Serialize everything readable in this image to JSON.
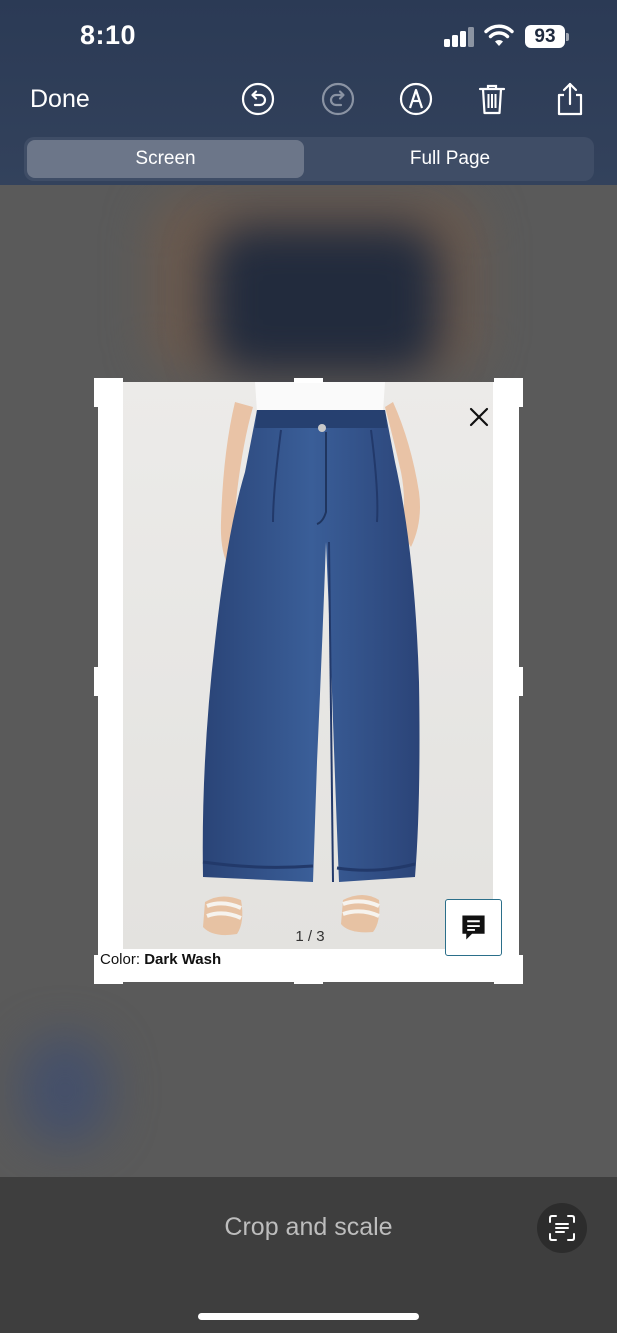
{
  "status": {
    "time": "8:10",
    "battery": "93"
  },
  "toolbar": {
    "done_label": "Done",
    "icons": [
      "undo-icon",
      "redo-icon",
      "markup-pen-icon",
      "trash-icon",
      "share-icon"
    ]
  },
  "segmented": {
    "options": [
      "Screen",
      "Full Page"
    ],
    "selected": "Screen"
  },
  "screenshot": {
    "image_counter": "1 / 3",
    "color_label": "Color:",
    "color_value": "Dark Wash"
  },
  "bottom": {
    "title": "Crop and scale"
  },
  "colors": {
    "header_bg": "#2b3a55",
    "segment_active": "#6c7689",
    "denim": "#2f4f86",
    "bottom_bar": "#3e3e3e"
  }
}
